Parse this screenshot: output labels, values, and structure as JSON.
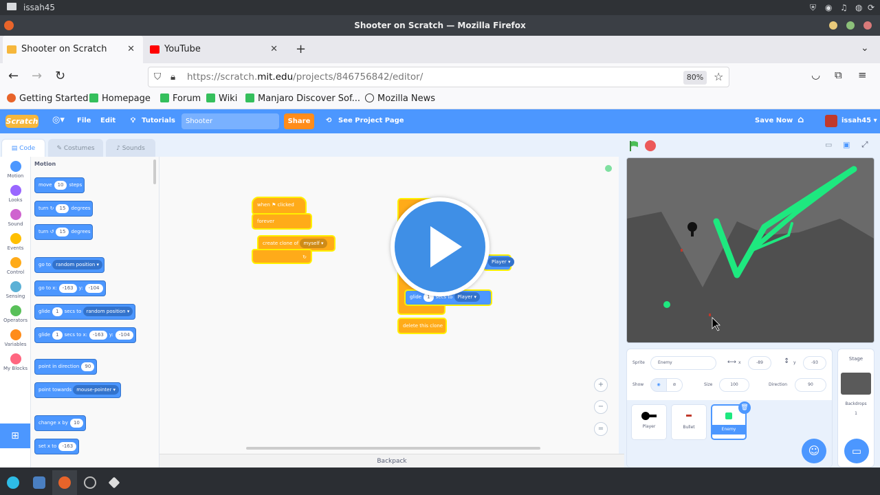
{
  "os": {
    "user": "issah45"
  },
  "window": {
    "title": "Shooter on Scratch — Mozilla Firefox"
  },
  "tabs": [
    {
      "label": "Shooter on Scratch",
      "close": "✕"
    },
    {
      "label": "YouTube",
      "close": "✕"
    }
  ],
  "newtab": "+",
  "url": {
    "prefix": "https://scratch.",
    "domain": "mit.edu",
    "path": "/projects/846756842/editor/",
    "zoom": "80%"
  },
  "bookmarks": [
    "Getting Started",
    "Homepage",
    "Forum",
    "Wiki",
    "Manjaro Discover Sof...",
    "Mozilla News"
  ],
  "scratch": {
    "logo": "Scratch",
    "menu": {
      "file": "File",
      "edit": "Edit",
      "tutorials": "Tutorials",
      "title": "Shooter",
      "share": "Share",
      "see_project": "See Project Page",
      "save": "Save Now",
      "user": "issah45"
    },
    "tabs": {
      "code": "Code",
      "costumes": "Costumes",
      "sounds": "Sounds"
    },
    "categories": [
      {
        "name": "Motion",
        "color": "#4c97ff"
      },
      {
        "name": "Looks",
        "color": "#9966ff"
      },
      {
        "name": "Sound",
        "color": "#cf63cf"
      },
      {
        "name": "Events",
        "color": "#ffbf00"
      },
      {
        "name": "Control",
        "color": "#ffab19"
      },
      {
        "name": "Sensing",
        "color": "#5cb1d6"
      },
      {
        "name": "Operators",
        "color": "#59c059"
      },
      {
        "name": "Variables",
        "color": "#ff8c1a"
      },
      {
        "name": "My Blocks",
        "color": "#ff6680"
      }
    ],
    "palette": {
      "heading": "Motion",
      "move": {
        "a": "move",
        "n": "10",
        "b": "steps"
      },
      "turn_right": {
        "a": "turn",
        "n": "15",
        "b": "degrees"
      },
      "turn_left": {
        "a": "turn",
        "n": "15",
        "b": "degrees"
      },
      "goto": {
        "a": "go to",
        "dd": "random position"
      },
      "goto_xy": {
        "a": "go to x:",
        "x": "-163",
        "b": "y:",
        "y": "-104"
      },
      "glide": {
        "a": "glide",
        "n": "1",
        "b": "secs to",
        "dd": "random position"
      },
      "glide_xy": {
        "a": "glide",
        "n": "1",
        "b": "secs to x:",
        "x": "-163",
        "c": "y:",
        "y": "-104"
      },
      "point_dir": {
        "a": "point in direction",
        "n": "90"
      },
      "point_towards": {
        "a": "point towards",
        "dd": "mouse-pointer"
      },
      "change_x": {
        "a": "change x by",
        "n": "10"
      },
      "set_x": {
        "a": "set x to",
        "n": "-163"
      }
    },
    "script1": {
      "hat": "when ⚑ clicked",
      "forever": "forever",
      "clone": "create clone of",
      "clone_dd": "myself"
    },
    "script2": {
      "dd": "Player",
      "glide": "glide",
      "glide_n": "1",
      "glide_b": "secs to",
      "glide_dd": "Player",
      "delete": "delete this clone"
    },
    "backpack": "Backpack",
    "sprite": {
      "label": "Sprite",
      "name": "Enemy",
      "x_label": "x",
      "x": "-89",
      "y_label": "y",
      "y": "-93",
      "show": "Show",
      "size_label": "Size",
      "size": "100",
      "direction_label": "Direction",
      "direction": "90"
    },
    "sprites": [
      "Player",
      "Bullet",
      "Enemy"
    ],
    "stage_panel": {
      "title": "Stage",
      "backdrops": "Backdrops",
      "count": "1"
    }
  },
  "colors": {
    "scratch_blue": "#4c97ff",
    "orange": "#ff8c1a",
    "green_line": "#1ee87f"
  }
}
